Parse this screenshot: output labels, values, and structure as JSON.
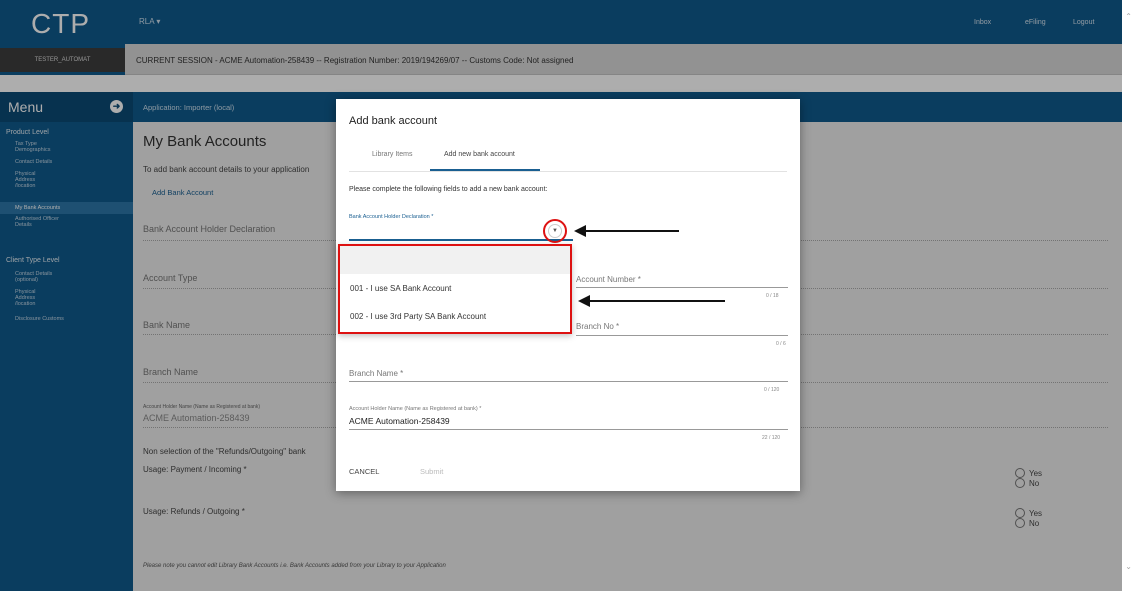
{
  "app": {
    "logo": "CTP",
    "user": "TESTER_AUTOMAT",
    "menu_label": "RLA",
    "links": [
      "Inbox",
      "eFiling",
      "Logout"
    ],
    "session": "CURRENT SESSION - ACME Automation-258439 -- Registration Number: 2019/194269/07 -- Customs Code: Not assigned"
  },
  "menu": {
    "title": "Menu",
    "product_level": {
      "label": "Product Level",
      "items": [
        "Tax Type Demographics",
        "Contact Details",
        "Physical Address /location",
        "My Bank Accounts",
        "Authorised Officer Details"
      ]
    },
    "client_type_level": {
      "label": "Client Type Level",
      "items": [
        "Contact Details (optional)",
        "Physical Address /location",
        "Disclosure Customs"
      ]
    }
  },
  "main": {
    "application": "Application: Importer (local)",
    "title": "My Bank Accounts",
    "subtitle": "To add bank account details to your application",
    "add_link": "Add Bank Account",
    "fields": {
      "holder_declaration": "Bank Account Holder Declaration",
      "account_type": "Account Type",
      "bank_name": "Bank Name",
      "branch_name": "Branch Name",
      "holder_name_label": "Account Holder Name (Name as Registered at bank)",
      "holder_name_value": "ACME Automation-258439"
    },
    "non_selection": "Non selection of the \"Refunds/Outgoing\" bank",
    "usage_payment": "Usage: Payment / Incoming *",
    "usage_refunds": "Usage: Refunds / Outgoing *",
    "yes": "Yes",
    "no": "No",
    "note": "Please note you cannot edit Library Bank Accounts i.e. Bank Accounts added from your Library to your Application"
  },
  "modal": {
    "title": "Add bank account",
    "tabs": [
      "Library Items",
      "Add new bank account"
    ],
    "active_tab": 1,
    "instruction": "Please complete the following fields to add a new bank account:",
    "declaration_label": "Bank Account Holder Declaration *",
    "account_number_label": "Account Number *",
    "account_number_count": "0 / 18",
    "branch_no_label": "Branch No *",
    "branch_no_count": "0 / 6",
    "branch_name_label": "Branch Name *",
    "branch_name_count": "0 / 120",
    "holder_name_label": "Account Holder Name (Name as Registered at bank) *",
    "holder_name_value": "ACME Automation-258439",
    "holder_name_count": "22 / 120",
    "cancel": "CANCEL",
    "submit": "Submit"
  },
  "dropdown": {
    "options": [
      "001 - I use SA Bank Account",
      "002 - I use 3rd Party SA Bank Account"
    ]
  },
  "colors": {
    "brand": "#0f5a8c",
    "accent": "#1a5f91",
    "annotation": "#dd1111"
  }
}
